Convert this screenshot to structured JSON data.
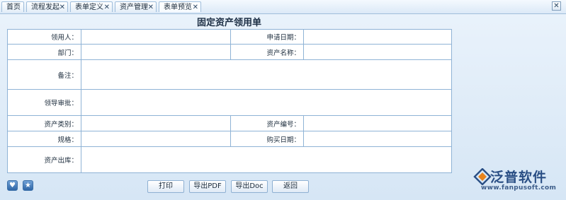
{
  "tabs": [
    {
      "label": "首页",
      "closable": false
    },
    {
      "label": "流程发起",
      "closable": true
    },
    {
      "label": "表单定义",
      "closable": true
    },
    {
      "label": "资产管理",
      "closable": true
    },
    {
      "label": "表单预览",
      "closable": true,
      "active": true
    }
  ],
  "close_symbol": "✕",
  "form": {
    "title": "固定资产领用单",
    "labels": {
      "applicant": "领用人：",
      "apply_date": "申请日期：",
      "department": "部门：",
      "asset_name": "资产名称：",
      "remark": "备注：",
      "leader_approval": "领导审批：",
      "asset_category": "资产类别：",
      "asset_number": "资产编号：",
      "spec": "规格：",
      "purchase_date": "购买日期：",
      "asset_outbound": "资产出库："
    },
    "values": {
      "applicant": "",
      "apply_date": "",
      "department": "",
      "asset_name": "",
      "remark": "",
      "leader_approval": "",
      "asset_category": "",
      "asset_number": "",
      "spec": "",
      "purchase_date": "",
      "asset_outbound": ""
    }
  },
  "buttons": {
    "print": "打印",
    "export_pdf": "导出PDF",
    "export_doc": "导出Doc",
    "back": "返回"
  },
  "icons": {
    "favorite": "heart-icon",
    "star": "star-icon"
  },
  "logo": {
    "brand": "泛普软件",
    "url": "www.fanpusoft.com"
  },
  "colors": {
    "border": "#8fb3d6",
    "brand": "#2a4f85",
    "accent": "#e8841c"
  }
}
